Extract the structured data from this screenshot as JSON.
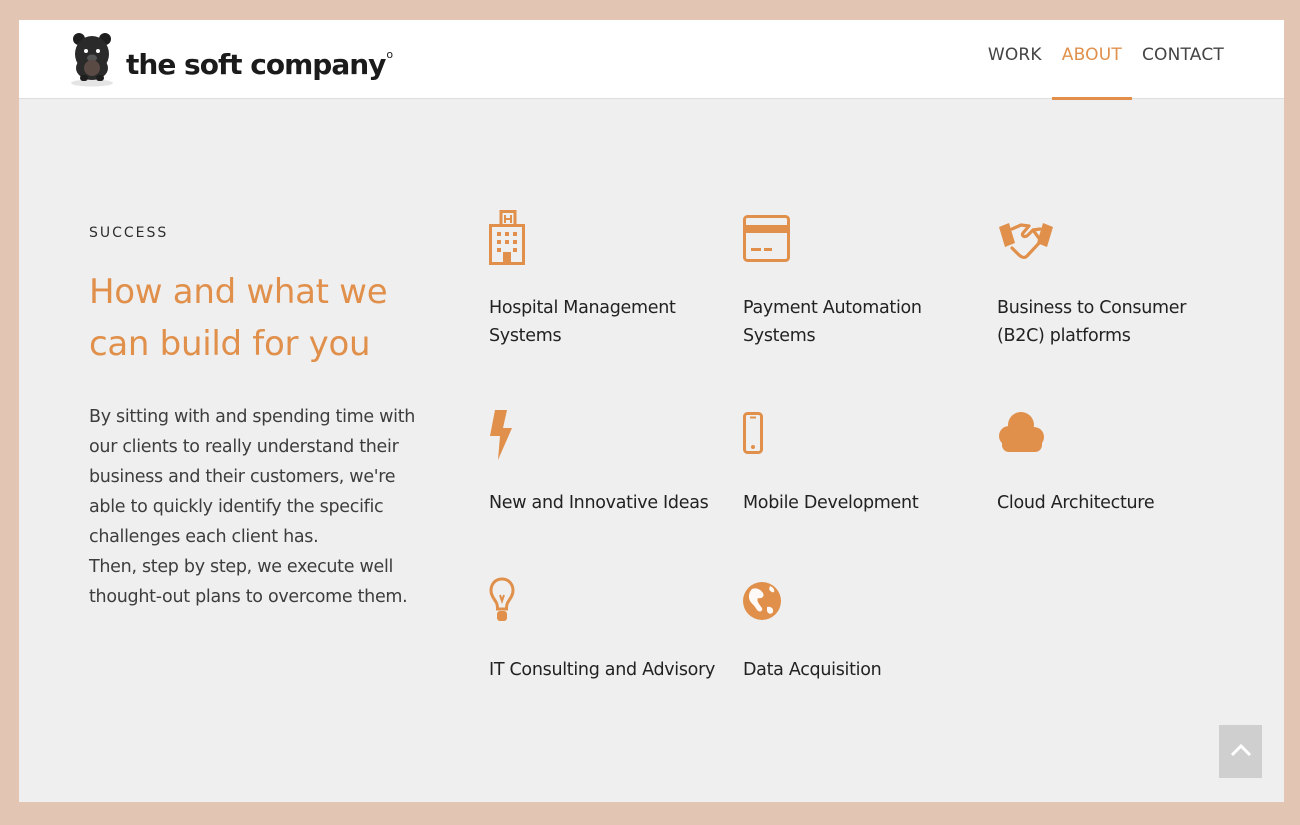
{
  "brand": {
    "name": "the soft company",
    "mark": "o"
  },
  "nav": [
    {
      "label": "WORK",
      "active": false
    },
    {
      "label": "ABOUT",
      "active": true
    },
    {
      "label": "CONTACT",
      "active": false
    }
  ],
  "section": {
    "eyebrow": "SUCCESS",
    "headline": "How and what we can build for you",
    "paragraphs": [
      "By sitting with and spending time with our clients to really understand their business and their customers, we're able to quickly identify the specific challenges each client has.",
      "Then, step by step, we execute well thought-out plans to overcome them."
    ]
  },
  "services": [
    {
      "icon": "hospital-icon",
      "label": "Hospital Management Systems"
    },
    {
      "icon": "credit-card-icon",
      "label": "Payment Automation Systems"
    },
    {
      "icon": "handshake-icon",
      "label": "Business to Consumer (B2C) platforms"
    },
    {
      "icon": "lightning-icon",
      "label": "New and Innovative Ideas"
    },
    {
      "icon": "mobile-icon",
      "label": "Mobile Development"
    },
    {
      "icon": "cloud-icon",
      "label": "Cloud Architecture"
    },
    {
      "icon": "lightbulb-icon",
      "label": "IT Consulting and Advisory"
    },
    {
      "icon": "globe-icon",
      "label": "Data Acquisition"
    }
  ],
  "colors": {
    "accent": "#e0904b",
    "page_border": "#e3c5b3",
    "content_bg": "#efefef",
    "scroll_top_bg": "#cfcfcf"
  }
}
